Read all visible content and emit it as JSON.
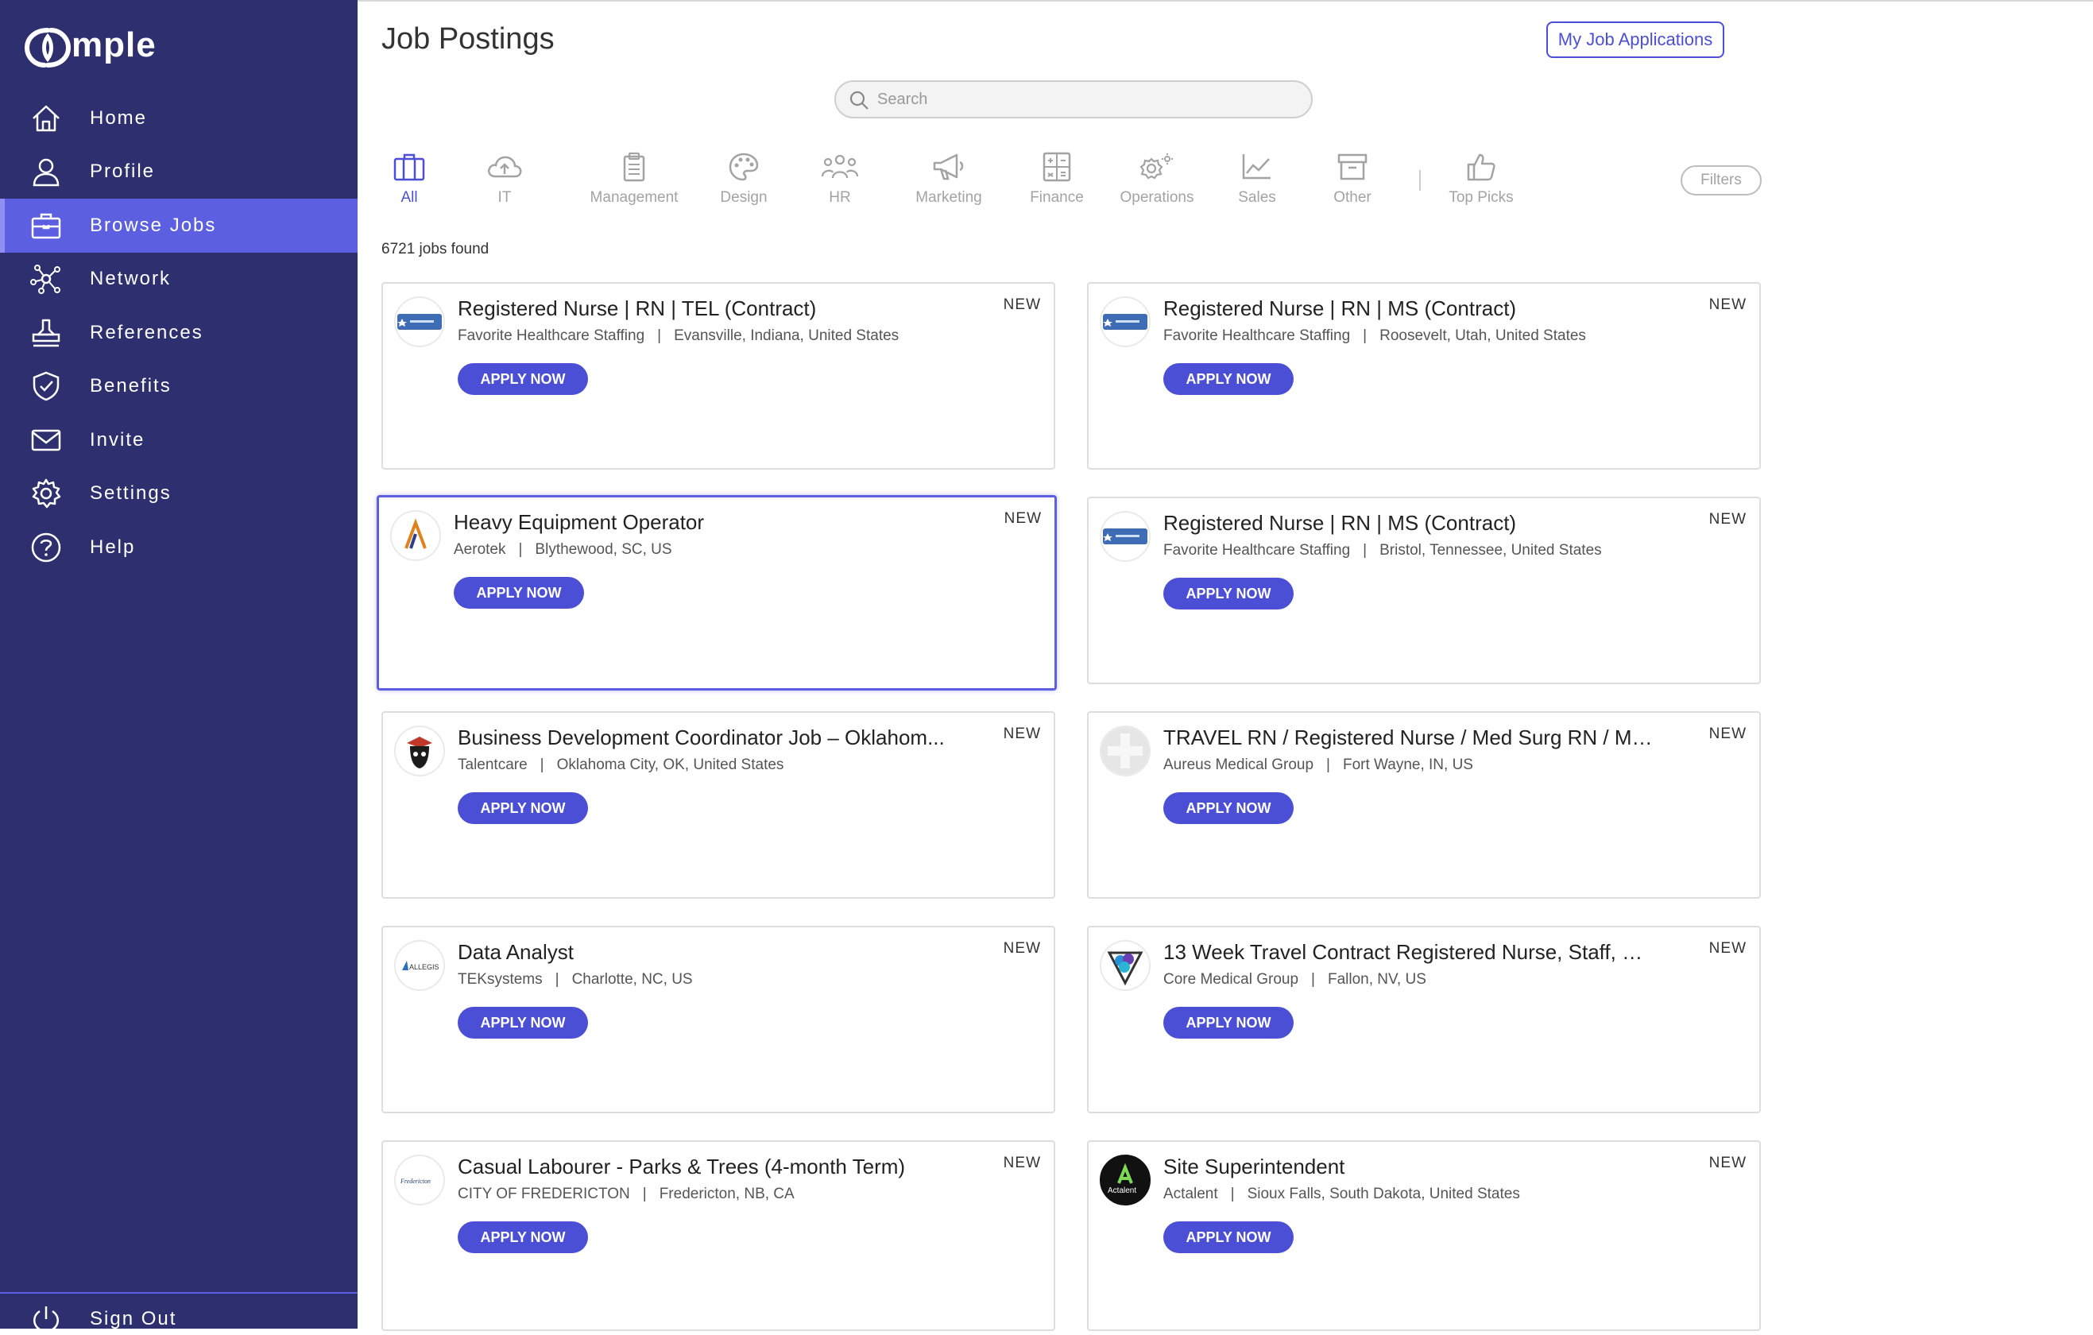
{
  "brand": {
    "logo_text": "mple",
    "accent": "#4b4fd6",
    "sidebar_bg": "#2d2f6e"
  },
  "sidebar": {
    "items": [
      {
        "label": "Home",
        "icon": "home-icon"
      },
      {
        "label": "Profile",
        "icon": "user-icon"
      },
      {
        "label": "Browse Jobs",
        "icon": "briefcase-icon",
        "active": true
      },
      {
        "label": "Network",
        "icon": "network-icon"
      },
      {
        "label": "References",
        "icon": "stamp-icon"
      },
      {
        "label": "Benefits",
        "icon": "shield-check-icon"
      },
      {
        "label": "Invite",
        "icon": "envelope-icon"
      },
      {
        "label": "Settings",
        "icon": "gear-icon"
      },
      {
        "label": "Help",
        "icon": "question-icon"
      }
    ],
    "sign_out": "Sign Out"
  },
  "header": {
    "title": "Job Postings",
    "my_applications": "My Job Applications",
    "search_placeholder": "Search"
  },
  "categories": [
    {
      "label": "All",
      "icon": "briefcase-icon",
      "active": true
    },
    {
      "label": "IT",
      "icon": "cloud-upload-icon"
    },
    {
      "label": "Management",
      "icon": "clipboard-icon"
    },
    {
      "label": "Design",
      "icon": "palette-icon"
    },
    {
      "label": "HR",
      "icon": "people-icon"
    },
    {
      "label": "Marketing",
      "icon": "megaphone-icon"
    },
    {
      "label": "Finance",
      "icon": "calculator-icon"
    },
    {
      "label": "Operations",
      "icon": "gears-icon"
    },
    {
      "label": "Sales",
      "icon": "chart-line-icon"
    },
    {
      "label": "Other",
      "icon": "archive-icon"
    },
    {
      "label": "Top Picks",
      "icon": "thumbs-up-icon"
    }
  ],
  "filters_label": "Filters",
  "jobs_found": "6721 jobs found",
  "jobs": [
    {
      "title": "Registered Nurse | RN | TEL (Contract)",
      "company": "Favorite Healthcare Staffing",
      "location": "Evansville, Indiana, United States",
      "badge": "NEW",
      "apply": "APPLY NOW",
      "logo": "favorite-logo"
    },
    {
      "title": "Registered Nurse | RN | MS (Contract)",
      "company": "Favorite Healthcare Staffing",
      "location": "Roosevelt, Utah, United States",
      "badge": "NEW",
      "apply": "APPLY NOW",
      "logo": "favorite-logo"
    },
    {
      "title": "Heavy Equipment Operator",
      "company": "Aerotek",
      "location": "Blythewood, SC, US",
      "badge": "NEW",
      "apply": "APPLY NOW",
      "logo": "aerotek-logo"
    },
    {
      "title": "Registered Nurse | RN | MS (Contract)",
      "company": "Favorite Healthcare Staffing",
      "location": "Bristol, Tennessee, United States",
      "badge": "NEW",
      "apply": "APPLY NOW",
      "logo": "favorite-logo"
    },
    {
      "title": "Business Development Coordinator Job – Oklahom...",
      "company": "Talentcare",
      "location": "Oklahoma City, OK, United States",
      "badge": "NEW",
      "apply": "APPLY NOW",
      "logo": "talentcare-logo"
    },
    {
      "title": "TRAVEL RN / Registered Nurse / Med Surg RN / Med...",
      "company": "Aureus Medical Group",
      "location": "Fort Wayne, IN, US",
      "badge": "NEW",
      "apply": "APPLY NOW",
      "logo": "aureus-logo"
    },
    {
      "title": "Data Analyst",
      "company": "TEKsystems",
      "location": "Charlotte, NC, US",
      "badge": "NEW",
      "apply": "APPLY NOW",
      "logo": "allegis-logo",
      "logo_text": "ALLEGIS"
    },
    {
      "title": "13 Week Travel Contract Registered Nurse, Staff, Crit...",
      "company": "Core Medical Group",
      "location": "Fallon, NV, US",
      "badge": "NEW",
      "apply": "APPLY NOW",
      "logo": "core-medical-logo"
    },
    {
      "title": "Casual Labourer - Parks & Trees (4-month Term)",
      "company": "CITY OF FREDERICTON",
      "location": "Fredericton, NB, CA",
      "badge": "NEW",
      "apply": "APPLY NOW",
      "logo": "fredericton-logo",
      "logo_text": "Fredericton"
    },
    {
      "title": "Site Superintendent",
      "company": "Actalent",
      "location": "Sioux Falls, South Dakota, United States",
      "badge": "NEW",
      "apply": "APPLY NOW",
      "logo": "actalent-logo",
      "logo_text": "Actalent"
    }
  ]
}
